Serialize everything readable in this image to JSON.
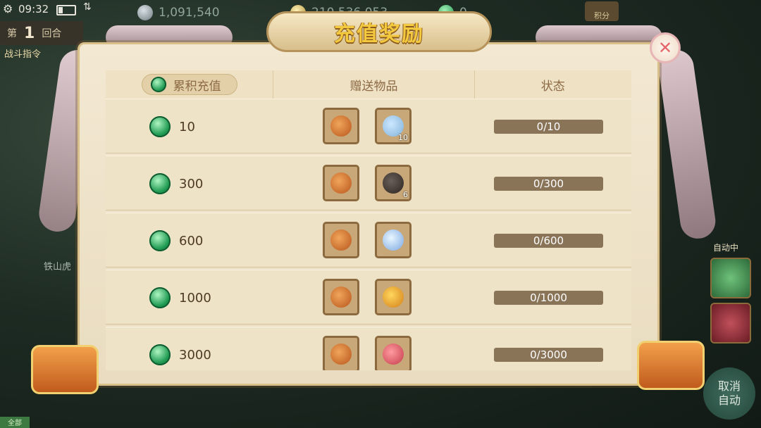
{
  "status_bar": {
    "time": "09:32"
  },
  "resources": [
    {
      "icon": "silver-coin-icon",
      "value": "1,091,540"
    },
    {
      "icon": "gold-coin-icon",
      "value": "210,536,053"
    },
    {
      "icon": "jade-icon",
      "value": "0"
    }
  ],
  "top_right_button": {
    "label": "积分"
  },
  "round": {
    "prefix": "第",
    "number": "1",
    "suffix": "回合"
  },
  "battle_command": {
    "label": "战斗指令"
  },
  "side_label": "铁山虎",
  "auto_panel": {
    "label": "自动中"
  },
  "cancel_auto": {
    "label_line1": "取消",
    "label_line2": "自动"
  },
  "bottom_tag": "全部",
  "dialog": {
    "title": "充值奖励",
    "close_icon": "close-icon",
    "headers": {
      "cumulative": "累积充值",
      "gifts": "赠送物品",
      "status": "状态"
    },
    "rows": [
      {
        "amount": "10",
        "items": [
          {
            "icon": "bag-with-silver-icon",
            "qty": ""
          },
          {
            "icon": "herb-vase-icon",
            "qty": "10"
          }
        ],
        "status": "0/10"
      },
      {
        "amount": "300",
        "items": [
          {
            "icon": "bag-with-silver-icon",
            "qty": ""
          },
          {
            "icon": "dark-ore-icon",
            "qty": "6"
          }
        ],
        "status": "0/300"
      },
      {
        "amount": "600",
        "items": [
          {
            "icon": "bag-with-silver-icon",
            "qty": ""
          },
          {
            "icon": "crystal-orb-icon",
            "qty": ""
          }
        ],
        "status": "0/600"
      },
      {
        "amount": "1000",
        "items": [
          {
            "icon": "bag-with-silver-icon",
            "qty": ""
          },
          {
            "icon": "golden-pouch-icon",
            "qty": ""
          }
        ],
        "status": "0/1000"
      },
      {
        "amount": "3000",
        "items": [
          {
            "icon": "bag-with-silver-icon",
            "qty": ""
          },
          {
            "icon": "red-pouch-icon",
            "qty": ""
          }
        ],
        "status": "0/3000"
      }
    ]
  },
  "colors": {
    "title": "#f3c93f",
    "status_bar_fill": "#8a7458",
    "jade": "#1f9a52"
  }
}
